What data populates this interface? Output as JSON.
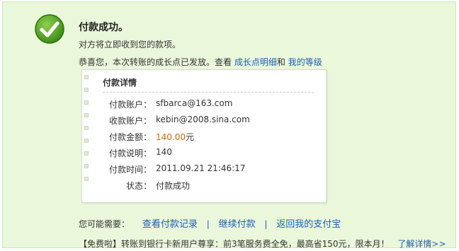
{
  "colors": {
    "panel_bg": "#eaf7da",
    "link": "#1a5fb4",
    "amount": "#d46b08",
    "check_green": "#4a9a1e"
  },
  "status": {
    "title": "付款成功。",
    "subtitle": "对方将立即收到您的款项。",
    "icon": "check-circle-icon"
  },
  "promo": {
    "text": "恭喜您，本次转账的成长点已发放。查看",
    "link1": "成长点明细",
    "and": "和",
    "link2": "我的等级"
  },
  "details": {
    "title": "付款详情",
    "rows": [
      {
        "label": "付款账户：",
        "value": "sfbarca@163.com"
      },
      {
        "label": "收款账户：",
        "value": "kebin@2008.sina.com"
      },
      {
        "label": "付款金额：",
        "value": "140.00",
        "unit": "元"
      },
      {
        "label": "付款说明：",
        "value": "140"
      },
      {
        "label": "付款时间：",
        "value": "2011.09.21 21:46:17"
      },
      {
        "label": "状态：",
        "value": "付款成功"
      }
    ]
  },
  "actions": {
    "lead": "您可能需要：",
    "items": [
      "查看付款记录",
      "继续付款",
      "返回我的支付宝"
    ],
    "separator": "|"
  },
  "footer": {
    "tag": "【免费啦】",
    "text": "转账到银行卡新用户尊享：前3笔服务费全免，最高省150元，限本月！",
    "link": "了解详情>>"
  }
}
